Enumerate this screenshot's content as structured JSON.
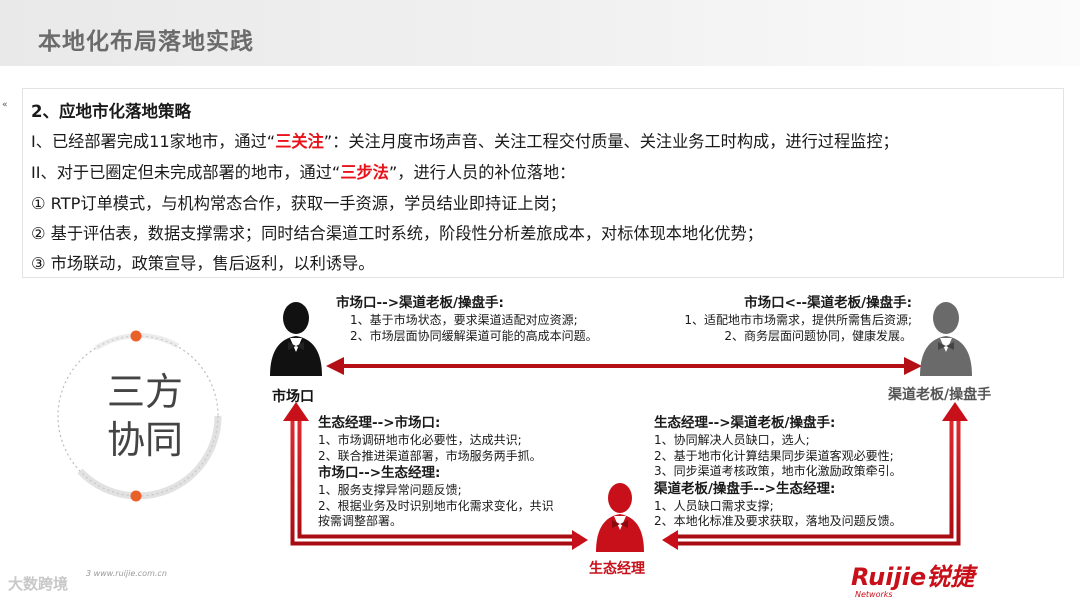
{
  "page_title": "本地化布局落地实践",
  "strategy": {
    "heading": "2、应地市化落地策略",
    "line1": {
      "pre": "I、已经部署完成11家地市，通过“",
      "highlight": "三关注",
      "post": "”：关注月度市场声音、关注工程交付质量、关注业务工时构成，进行过程监控；"
    },
    "line2": {
      "pre": "II、对于已圈定但未完成部署的地市，通过“",
      "highlight": "三步法",
      "post": "”，进行人员的补位落地："
    },
    "items": [
      "①  RTP订单模式，与机构常态合作，获取一手资源，学员结业即持证上岗；",
      "②  基于评估表，数据支撑需求；同时结合渠道工时系统，阶段性分析差旅成本，对标体现本地化优势；",
      "③  市场联动，政策宣导，售后返利，以利诱导。"
    ]
  },
  "diagram": {
    "center_line1": "三方",
    "center_line2": "协同",
    "actor_market": "市场口",
    "actor_channel": "渠道老板/操盘手",
    "actor_eco": "生态经理",
    "block_market_to_channel": {
      "title": "市场口-->渠道老板/操盘手:",
      "items": [
        "1、基于市场状态，要求渠道适配对应资源;",
        "2、市场层面协同缓解渠道可能的高成本问题。"
      ]
    },
    "block_channel_to_market": {
      "title": "市场口<--渠道老板/操盘手:",
      "items": [
        "1、适配地市市场需求，提供所需售后资源;",
        "2、商务层面问题协同，健康发展。"
      ]
    },
    "block_eco_to_market": {
      "title": "生态经理-->市场口:",
      "items": [
        "1、市场调研地市化必要性，达成共识;",
        "2、联合推进渠道部署，市场服务两手抓。"
      ],
      "title2": "市场口-->生态经理:",
      "items2": [
        "1、服务支撑异常问题反馈;",
        "2、根据业务及时识别地市化需求变化，共识",
        "按需调整部署。"
      ]
    },
    "block_eco_to_channel": {
      "title": "生态经理-->渠道老板/操盘手:",
      "items": [
        "1、协同解决人员缺口，选人;",
        "2、基于地市化计算结果同步渠道客观必要性;",
        "3、同步渠道考核政策，地市化激励政策牵引。"
      ],
      "title2": "渠道老板/操盘手-->生态经理:",
      "items2": [
        "1、人员缺口需求支撑;",
        "2、本地化标准及要求获取，落地及问题反馈。"
      ]
    }
  },
  "footer": {
    "url": "3  www.ruijie.com.cn",
    "watermark": "大数跨境",
    "logo_text": "Ruijie锐捷",
    "logo_sub": "Networks"
  },
  "colors": {
    "accent": "#c8101a",
    "highlight": "#e8121b",
    "dot": "#e8602a",
    "channel_gray": "#6a6a6a"
  }
}
